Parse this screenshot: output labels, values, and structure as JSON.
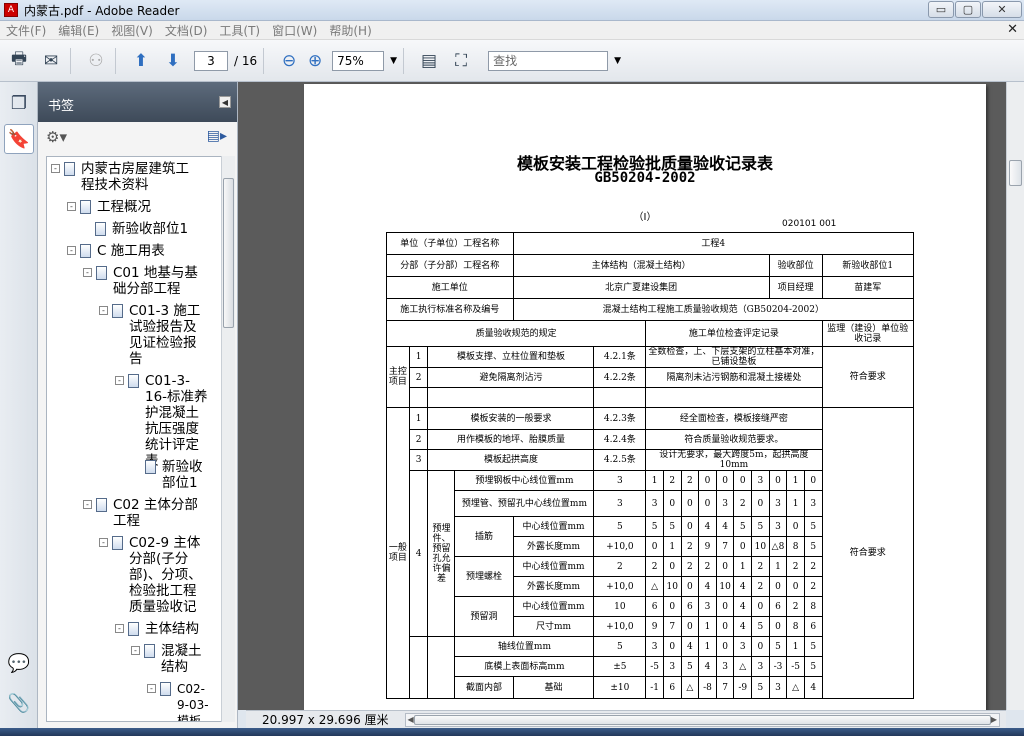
{
  "window": {
    "title": "内蒙古.pdf - Adobe Reader",
    "controls": [
      "▭",
      "▢",
      "✕"
    ]
  },
  "menu": [
    "文件(F)",
    "编辑(E)",
    "视图(V)",
    "文档(D)",
    "工具(T)",
    "窗口(W)",
    "帮助(H)"
  ],
  "toolbar": {
    "page_current": "3",
    "page_total": "/ 16",
    "zoom": "75%",
    "search_placeholder": "查找"
  },
  "bookmarks": {
    "header": "书签",
    "items": [
      {
        "label": "内蒙古房屋建筑工程技术资料",
        "toggle": "-"
      },
      {
        "label": "工程概况",
        "toggle": "-"
      },
      {
        "label": "新验收部位1",
        "toggle": ""
      },
      {
        "label": "C 施工用表",
        "toggle": "-"
      },
      {
        "label": "C01 地基与基础分部工程",
        "toggle": "-"
      },
      {
        "label": "C01-3 施工试验报告及见证检验报告",
        "toggle": "-"
      },
      {
        "label": "C01-3-16-标准养护混凝土抗压强度统计评定表",
        "toggle": "-"
      },
      {
        "label": "新验收部位1",
        "toggle": ""
      },
      {
        "label": "C02 主体分部工程",
        "toggle": "-"
      },
      {
        "label": "C02-9 主体分部(子分部)、分项、检验批工程质量验收记",
        "toggle": "-"
      },
      {
        "label": "主体结构",
        "toggle": "-"
      },
      {
        "label": "混凝土结构",
        "toggle": "-"
      },
      {
        "label": "C02-9-03-模板",
        "toggle": "-"
      }
    ]
  },
  "status": {
    "page_size": "20.997 x 29.696 厘米"
  },
  "document": {
    "title": "模板安装工程检验批质量验收记录表",
    "standard": "GB50204-2002",
    "roman": "（Ⅰ）",
    "code": "020101  001",
    "rows": {
      "unit_project_label": "单位（子单位）工程名称",
      "unit_project_value": "工程4",
      "sub_project_label": "分部（子分部）工程名称",
      "sub_project_value": "主体结构（混凝土结构）",
      "acceptance_part_label": "验收部位",
      "acceptance_part_value": "新验收部位1",
      "contractor_label": "施工单位",
      "contractor_value": "北京广夏建设集团",
      "manager_label": "项目经理",
      "manager_value": "苗建军",
      "standard_label": "施工执行标准名称及编号",
      "standard_value": "混凝土结构工程施工质量验收规范（GB50204-2002）",
      "col_spec": "质量验收规范的规定",
      "col_contractor_check": "施工单位检查评定记录",
      "col_supervisor": "监理（建设）单位验收记录",
      "main_control": "主控项目",
      "general": "一般项目",
      "conclusion": "符合要求"
    },
    "main_items": [
      {
        "no": "1",
        "name": "模板支撑、立柱位置和垫板",
        "clause": "4.2.1条",
        "record": "全数检查，上、下层支架的立柱基本对准，已铺设垫板"
      },
      {
        "no": "2",
        "name": "避免隔离剂沾污",
        "clause": "4.2.2条",
        "record": "隔离剂未沾污钢筋和混凝土接槎处"
      }
    ],
    "general_items": [
      {
        "no": "1",
        "name": "模板安装的一般要求",
        "clause": "4.2.3条",
        "record": "经全面检查，模板接缝严密"
      },
      {
        "no": "2",
        "name": "用作模板的地坪、胎膜质量",
        "clause": "4.2.4条",
        "record": "符合质量验收规范要求。"
      },
      {
        "no": "3",
        "name": "模板起拱高度",
        "clause": "4.2.5条",
        "record": "设计无要求，最大跨度5m，起拱高度10mm"
      }
    ],
    "deviation_group": "预埋件、预留孔允许偏差",
    "deviation_no": "4",
    "deviation_rows": [
      {
        "group": "",
        "item": "预埋钢板中心线位置mm",
        "limit": "3",
        "values": [
          "1",
          "2",
          "2",
          "0",
          "0",
          "0",
          "3",
          "0",
          "1",
          "0"
        ]
      },
      {
        "group": "",
        "item": "预埋管、预留孔中心线位置mm",
        "limit": "3",
        "values": [
          "3",
          "0",
          "0",
          "0",
          "3",
          "2",
          "0",
          "3",
          "1",
          "3"
        ]
      },
      {
        "group": "插筋",
        "item": "中心线位置mm",
        "limit": "5",
        "values": [
          "5",
          "5",
          "0",
          "4",
          "4",
          "5",
          "5",
          "3",
          "0",
          "5"
        ]
      },
      {
        "group": "",
        "item": "外露长度mm",
        "limit": "+10,0",
        "values": [
          "0",
          "1",
          "2",
          "9",
          "7",
          "0",
          "10",
          "△8",
          "8",
          "5"
        ]
      },
      {
        "group": "预埋螺栓",
        "item": "中心线位置mm",
        "limit": "2",
        "values": [
          "2",
          "0",
          "2",
          "2",
          "0",
          "1",
          "2",
          "1",
          "2",
          "2"
        ]
      },
      {
        "group": "",
        "item": "外露长度mm",
        "limit": "+10,0",
        "values": [
          "△",
          "10",
          "0",
          "4",
          "10",
          "4",
          "2",
          "0",
          "0",
          "2"
        ]
      },
      {
        "group": "预留洞",
        "item": "中心线位置mm",
        "limit": "10",
        "values": [
          "6",
          "0",
          "6",
          "3",
          "0",
          "4",
          "0",
          "6",
          "2",
          "8"
        ]
      },
      {
        "group": "",
        "item": "尺寸mm",
        "limit": "+10,0",
        "values": [
          "9",
          "7",
          "0",
          "1",
          "0",
          "4",
          "5",
          "0",
          "8",
          "6"
        ]
      }
    ],
    "extra_rows": [
      {
        "item": "轴线位置mm",
        "limit": "5",
        "values": [
          "3",
          "0",
          "4",
          "1",
          "0",
          "3",
          "0",
          "5",
          "1",
          "5"
        ]
      },
      {
        "item": "底模上表面标高mm",
        "limit": "±5",
        "values": [
          "-5",
          "3",
          "5",
          "4",
          "3",
          "△",
          "3",
          "-3",
          "-5",
          "5"
        ]
      },
      {
        "group": "截面内部",
        "item": "基础",
        "limit": "±10",
        "values": [
          "-1",
          "6",
          "△",
          "-8",
          "7",
          "-9",
          "5",
          "3",
          "△",
          "4"
        ]
      }
    ]
  }
}
